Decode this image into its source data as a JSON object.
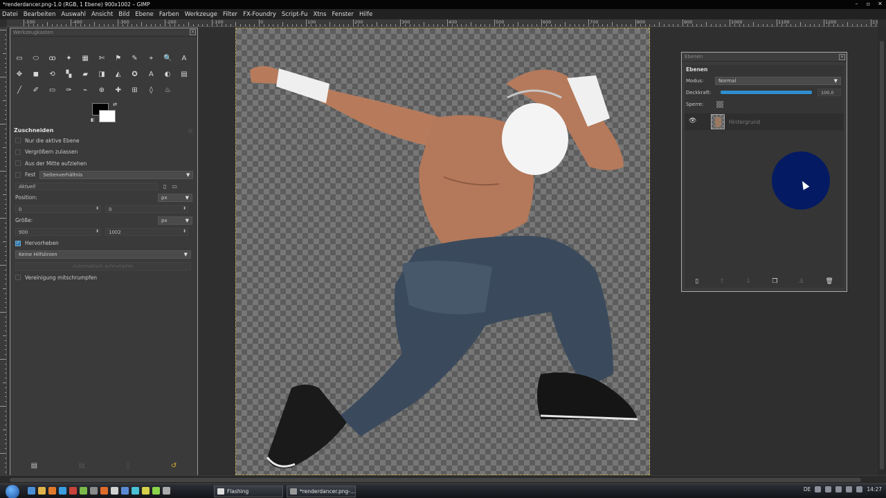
{
  "window": {
    "title": "*renderdancer.png-1.0 (RGB, 1 Ebene) 900x1002 – GIMP",
    "controls": [
      "minimize-icon",
      "maximize-icon",
      "close-icon"
    ]
  },
  "menu": [
    "Datei",
    "Bearbeiten",
    "Auswahl",
    "Ansicht",
    "Bild",
    "Ebene",
    "Farben",
    "Werkzeuge",
    "Filter",
    "FX-Foundry",
    "Script-Fu",
    "Xtns",
    "Fenster",
    "Hilfe"
  ],
  "ruler": {
    "h_labels": [
      "-500",
      "-400",
      "-300",
      "-200",
      "-100",
      "0",
      "100",
      "200",
      "300",
      "400",
      "500",
      "600",
      "700",
      "800",
      "900",
      "1000",
      "1100",
      "1200",
      "1300"
    ],
    "v_labels": [
      "0",
      "100",
      "200",
      "300",
      "400",
      "500",
      "600",
      "700",
      "800",
      "900"
    ]
  },
  "toolbox": {
    "title": "Werkzeugkasten",
    "tools": [
      "rect-select-icon",
      "ellipse-select-icon",
      "lasso-icon",
      "fuzzy-select-icon",
      "color-select-icon",
      "scissors-icon",
      "foreground-select-icon",
      "paths-icon",
      "color-picker-icon",
      "zoom-icon",
      "measure-icon",
      "move-icon",
      "crop-icon",
      "rotate-icon",
      "scale-icon",
      "shear-icon",
      "perspective-icon",
      "flip-icon",
      "cage-icon",
      "text-icon",
      "bucket-fill-icon",
      "blend-icon",
      "pencil-icon",
      "paintbrush-icon",
      "eraser-icon",
      "airbrush-icon",
      "ink-icon",
      "clone-icon",
      "heal-icon",
      "perspective-clone-icon",
      "blur-icon",
      "smudge-icon",
      "dodge-burn-icon"
    ],
    "tool_glyphs": [
      "▭",
      "⬭",
      "ꝏ",
      "✦",
      "▦",
      "✄",
      "⚑",
      "✎",
      "⌖",
      "🔍",
      "A",
      "✥",
      "◼",
      "⟲",
      "▚",
      "▰",
      "◨",
      "◭",
      "✪",
      "A",
      "◐",
      "▤",
      "╱",
      "✐",
      "▭",
      "✑",
      "⌁",
      "⊕",
      "✚",
      "⊞",
      "◊",
      "♨",
      ""
    ],
    "options": {
      "title": "Zuschneiden",
      "only_active_layer": "Nur die aktive Ebene",
      "allow_grow": "Vergrößern zulassen",
      "expand_center": "Aus der Mitte aufziehen",
      "fixed_label": "Fest",
      "fixed_value": "Seitenverhältnis",
      "current_placeholder": "Aktuell",
      "position_label": "Position:",
      "position_unit": "px",
      "position_x": "0",
      "position_y": "0",
      "size_label": "Größe:",
      "size_unit": "px",
      "size_w": "900",
      "size_h": "1002",
      "highlight_label": "Hervorheben",
      "guides_value": "Keine Hilfslinien",
      "auto_shrink": "Automatisch schrumpfen",
      "shrink_merged": "Vereinigung mitschrumpfen"
    },
    "bottom_icons": [
      "save-options-icon",
      "restore-options-icon",
      "delete-options-icon",
      "reset-options-icon"
    ]
  },
  "layers": {
    "window_title": "Ebenen",
    "panel_title": "Ebenen",
    "mode_label": "Modus:",
    "mode_value": "Normal",
    "opacity_label": "Deckkraft:",
    "opacity_value": "100,0",
    "opacity_fraction": 1.0,
    "lock_label": "Sperre:",
    "layer_name": "Hintergrund",
    "footer_icons": [
      "new-layer-icon",
      "raise-layer-icon",
      "lower-layer-icon",
      "duplicate-layer-icon",
      "anchor-layer-icon",
      "delete-layer-icon"
    ]
  },
  "taskbar": {
    "tasks": [
      "Flashing",
      "*renderdancer.png-..."
    ],
    "lang": "DE",
    "time": "14:27"
  },
  "colors": {
    "accent": "#2f8fd0",
    "cursor_highlight": "#041a63",
    "selection_border": "#b9a64a"
  }
}
